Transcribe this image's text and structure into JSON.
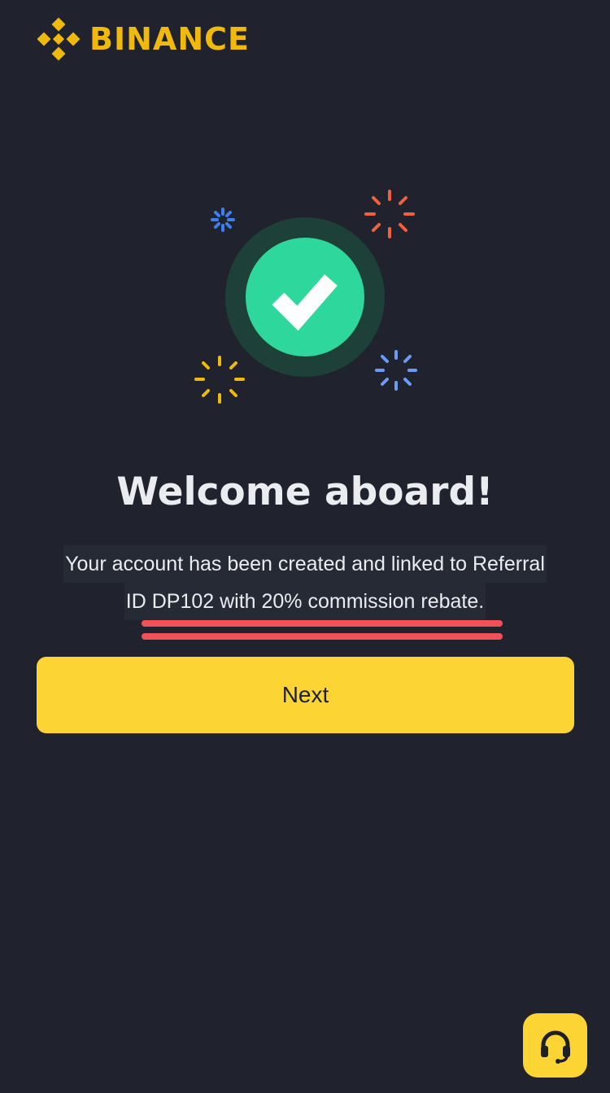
{
  "brand": {
    "name": "BINANCE",
    "logo_icon": "binance-logo-icon",
    "color": "#f0b90b"
  },
  "hero": {
    "icon": "check-circle-icon",
    "sparkle_icons": [
      "sparkle-icon-blue",
      "sparkle-icon-orange",
      "sparkle-icon-yellow",
      "sparkle-icon-lightblue"
    ],
    "check_color": "#2ed79b"
  },
  "title": "Welcome aboard!",
  "message": {
    "line1": "Your account  has been created and linked to Referral",
    "line2": "ID DP102 with 20% commission rebate.",
    "highlight_color": "#f25159"
  },
  "actions": {
    "next_label": "Next",
    "support_icon": "headset-icon"
  },
  "colors": {
    "background": "#20232d",
    "primary_button": "#fcd535",
    "text": "#eaecef"
  }
}
